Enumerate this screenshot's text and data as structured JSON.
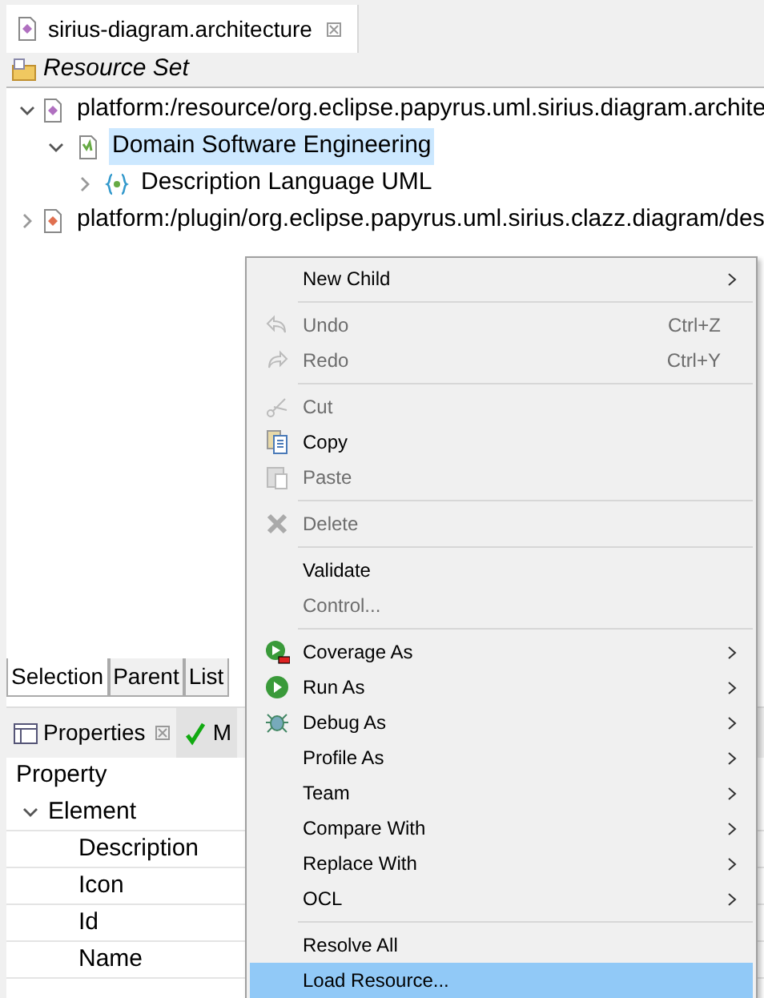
{
  "editor_tab": {
    "title": "sirius-diagram.architecture"
  },
  "resource_set": {
    "label": "Resource Set"
  },
  "tree": [
    {
      "label": "platform:/resource/org.eclipse.papyrus.uml.sirius.diagram.archite",
      "expanded": true,
      "selected": false,
      "children": [
        {
          "label": "Domain Software Engineering",
          "expanded": true,
          "selected": true,
          "children": [
            {
              "label": "Description Language UML",
              "expanded": false,
              "selected": false
            }
          ]
        }
      ]
    },
    {
      "label": "platform:/plugin/org.eclipse.papyrus.uml.sirius.clazz.diagram/des",
      "expanded": false,
      "selected": false
    }
  ],
  "editor_tabs": [
    {
      "label": "Selection",
      "selected": true
    },
    {
      "label": "Parent",
      "selected": false
    },
    {
      "label": "List",
      "selected": false
    }
  ],
  "views": [
    {
      "label": "Properties",
      "selected": true
    },
    {
      "label": "M",
      "selected": false
    }
  ],
  "properties": {
    "column": "Property",
    "rows": [
      {
        "label": "Element",
        "expanded": true,
        "children": [
          {
            "label": "Description"
          },
          {
            "label": "Icon"
          },
          {
            "label": "Id"
          },
          {
            "label": "Name"
          }
        ]
      }
    ]
  },
  "menu": [
    [
      {
        "label": "New Child",
        "disabled": false,
        "submenu": true,
        "selected": false
      }
    ],
    [
      {
        "label": "Undo",
        "disabled": true,
        "shortcut": "Ctrl+Z",
        "selected": false
      },
      {
        "label": "Redo",
        "disabled": true,
        "shortcut": "Ctrl+Y",
        "selected": false
      }
    ],
    [
      {
        "label": "Cut",
        "disabled": true,
        "selected": false
      },
      {
        "label": "Copy",
        "disabled": false,
        "selected": false
      },
      {
        "label": "Paste",
        "disabled": true,
        "selected": false
      }
    ],
    [
      {
        "label": "Delete",
        "disabled": true,
        "selected": false
      }
    ],
    [
      {
        "label": "Validate",
        "disabled": false,
        "selected": false
      },
      {
        "label": "Control...",
        "disabled": true,
        "selected": false
      }
    ],
    [
      {
        "label": "Coverage As",
        "disabled": false,
        "submenu": true,
        "selected": false
      },
      {
        "label": "Run As",
        "disabled": false,
        "submenu": true,
        "selected": false
      },
      {
        "label": "Debug As",
        "disabled": false,
        "submenu": true,
        "selected": false
      },
      {
        "label": "Profile As",
        "disabled": false,
        "submenu": true,
        "selected": false
      },
      {
        "label": "Team",
        "disabled": false,
        "submenu": true,
        "selected": false
      },
      {
        "label": "Compare With",
        "disabled": false,
        "submenu": true,
        "selected": false
      },
      {
        "label": "Replace With",
        "disabled": false,
        "submenu": true,
        "selected": false
      },
      {
        "label": "OCL",
        "disabled": false,
        "submenu": true,
        "selected": false
      }
    ],
    [
      {
        "label": "Resolve All",
        "disabled": false,
        "selected": false
      },
      {
        "label": "Load Resource...",
        "disabled": false,
        "selected": true
      }
    ]
  ]
}
